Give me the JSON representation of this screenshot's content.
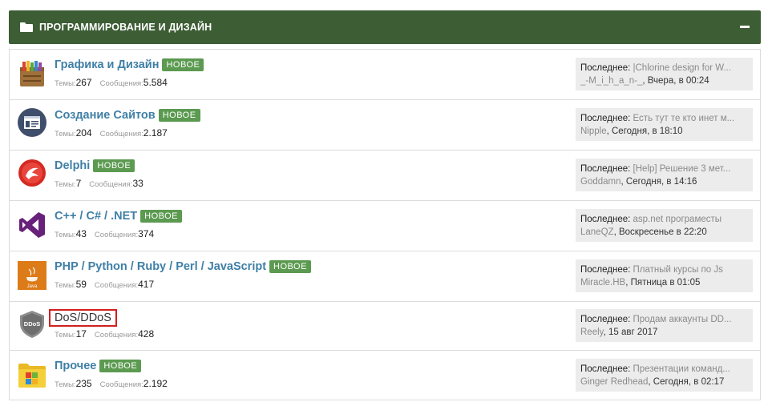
{
  "category": {
    "title": "ПРОГРАММИРОВАНИЕ И ДИЗАЙН",
    "folder_icon": "folder-icon",
    "collapse_icon": "minus-icon",
    "header_color": "#3d5d35"
  },
  "labels": {
    "threads": "Темы:",
    "messages": "Сообщения:",
    "last": "Последнее:",
    "new_badge": "НОВОЕ"
  },
  "forums": [
    {
      "name": "Графика и Дизайн",
      "icon": "paint-palette-icon",
      "badge": true,
      "threads": "267",
      "messages": "5.584",
      "last_title": "|Chlorine design for W...",
      "last_user": "_-M_i_h_a_n-_",
      "last_time": ", Вчера, в 00:24"
    },
    {
      "name": "Создание Сайтов",
      "icon": "web-window-icon",
      "badge": true,
      "threads": "204",
      "messages": "2.187",
      "last_title": "Есть тут те кто инет м...",
      "last_user": "Nipple",
      "last_time": ", Сегодня, в 18:10"
    },
    {
      "name": "Delphi",
      "icon": "delphi-logo-icon",
      "badge": true,
      "threads": "7",
      "messages": "33",
      "last_title": "[Help] Решение 3 мет...",
      "last_user": "Goddamn",
      "last_time": ", Сегодня, в 14:16"
    },
    {
      "name": "C++ / C# / .NET",
      "icon": "visual-studio-icon",
      "badge": true,
      "threads": "43",
      "messages": "374",
      "last_title": "asp.net програместы",
      "last_user": "LaneQZ",
      "last_time": ", Воскресенье в 22:20"
    },
    {
      "name": "PHP / Python / Ruby / Perl / JavaScript",
      "icon": "java-icon",
      "badge": true,
      "threads": "59",
      "messages": "417",
      "last_title": "Платный курсы по Js",
      "last_user": "Miracle.HB",
      "last_time": ", Пятница в 01:05"
    },
    {
      "name": "DoS/DDoS",
      "icon": "ddos-shield-icon",
      "badge": false,
      "threads": "17",
      "messages": "428",
      "last_title": "Продам аккаунты DD...",
      "last_user": "Reely",
      "last_time": ", 15 авг 2017"
    },
    {
      "name": "Прочее",
      "icon": "windows-folder-icon",
      "badge": true,
      "threads": "235",
      "messages": "2.192",
      "last_title": "Презентации команд...",
      "last_user": "Ginger Redhead",
      "last_time": ", Сегодня, в 02:17"
    }
  ]
}
